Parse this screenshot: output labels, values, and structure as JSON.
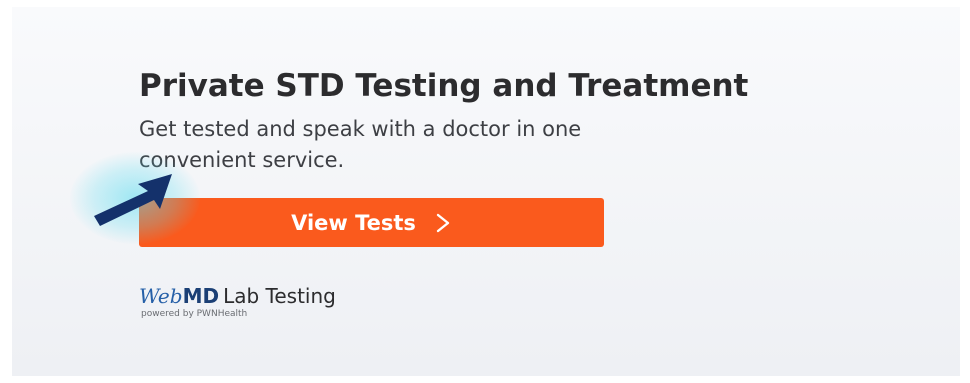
{
  "ad": {
    "headline": "Private STD Testing and Treatment",
    "subtext": "Get tested and speak with a doctor in one convenient service.",
    "cta_label": "View Tests",
    "brand": {
      "logo_web": "Web",
      "logo_md": "MD",
      "product": "Lab Testing",
      "powered_by": "powered by PWNHealth"
    }
  },
  "icons": {
    "cta": "chevron-right-icon",
    "pointer": "pointer-arrow-icon"
  },
  "colors": {
    "cta_background": "#fa5a1d",
    "headline": "#2c2c2e",
    "brand_blue": "#2660a8",
    "pointer": "#14316b",
    "pointer_glow": "#5adcf0"
  }
}
